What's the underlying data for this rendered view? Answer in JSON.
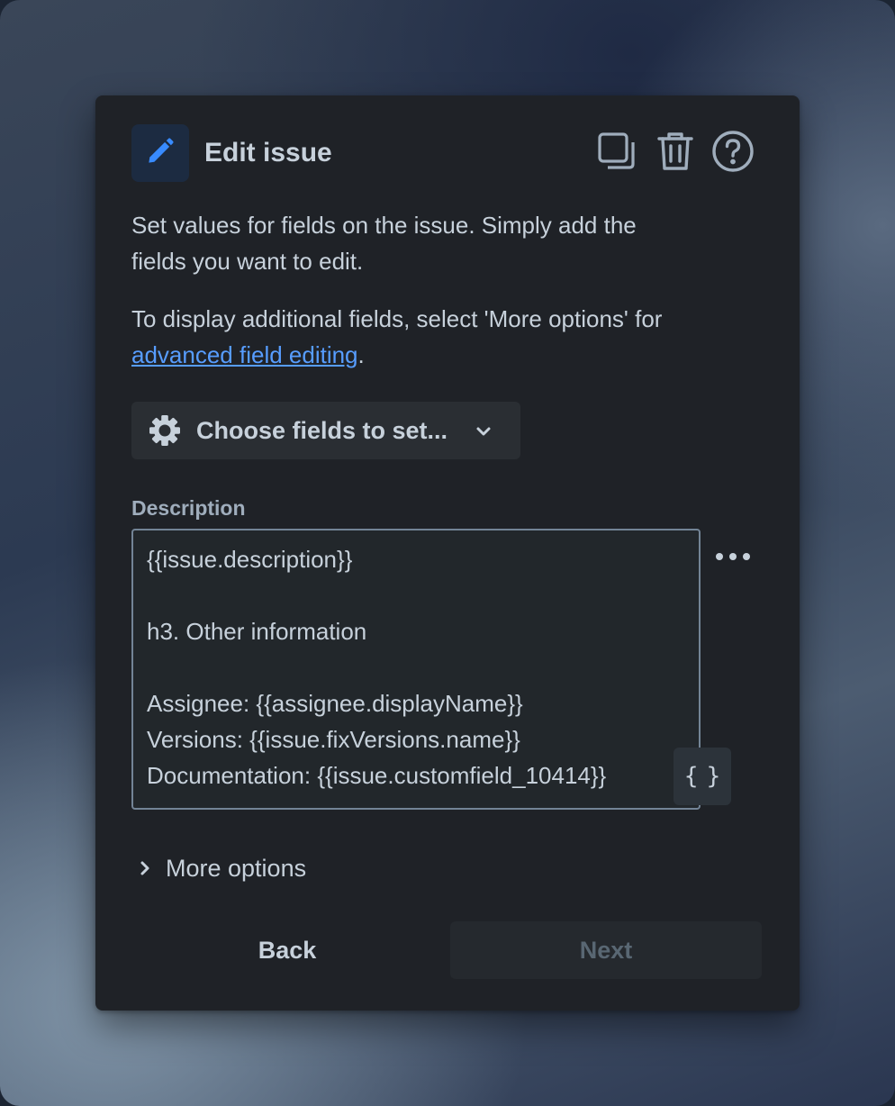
{
  "header": {
    "title": "Edit issue",
    "icons": [
      "pencil-icon",
      "copy-icon",
      "trash-icon",
      "help-icon"
    ]
  },
  "intro": {
    "line1": "Set values for fields on the issue. Simply add the",
    "line2": "fields you want to edit.",
    "line3": "To display additional fields, select 'More options' for",
    "link_text": "advanced field editing",
    "link_suffix": "."
  },
  "choose_fields": {
    "label": "Choose fields to set...",
    "icon": "gear-icon"
  },
  "description": {
    "label": "Description",
    "lines": [
      "{{issue.description}}",
      "",
      "h3. Other information",
      "",
      "Assignee: {{assignee.displayName}}",
      "Versions: {{issue.fixVersions.name}}",
      "Documentation: {{issue.customfield_10414}}"
    ],
    "smart_value_button": "{ }"
  },
  "more_options": {
    "label": "More options"
  },
  "footer": {
    "back_label": "Back",
    "next_label": "Next"
  },
  "colors": {
    "panel": "#1f2227",
    "text": "#c7d1db",
    "link": "#579dff",
    "accent_icon": "#388bff",
    "disabled_text": "#596773"
  }
}
